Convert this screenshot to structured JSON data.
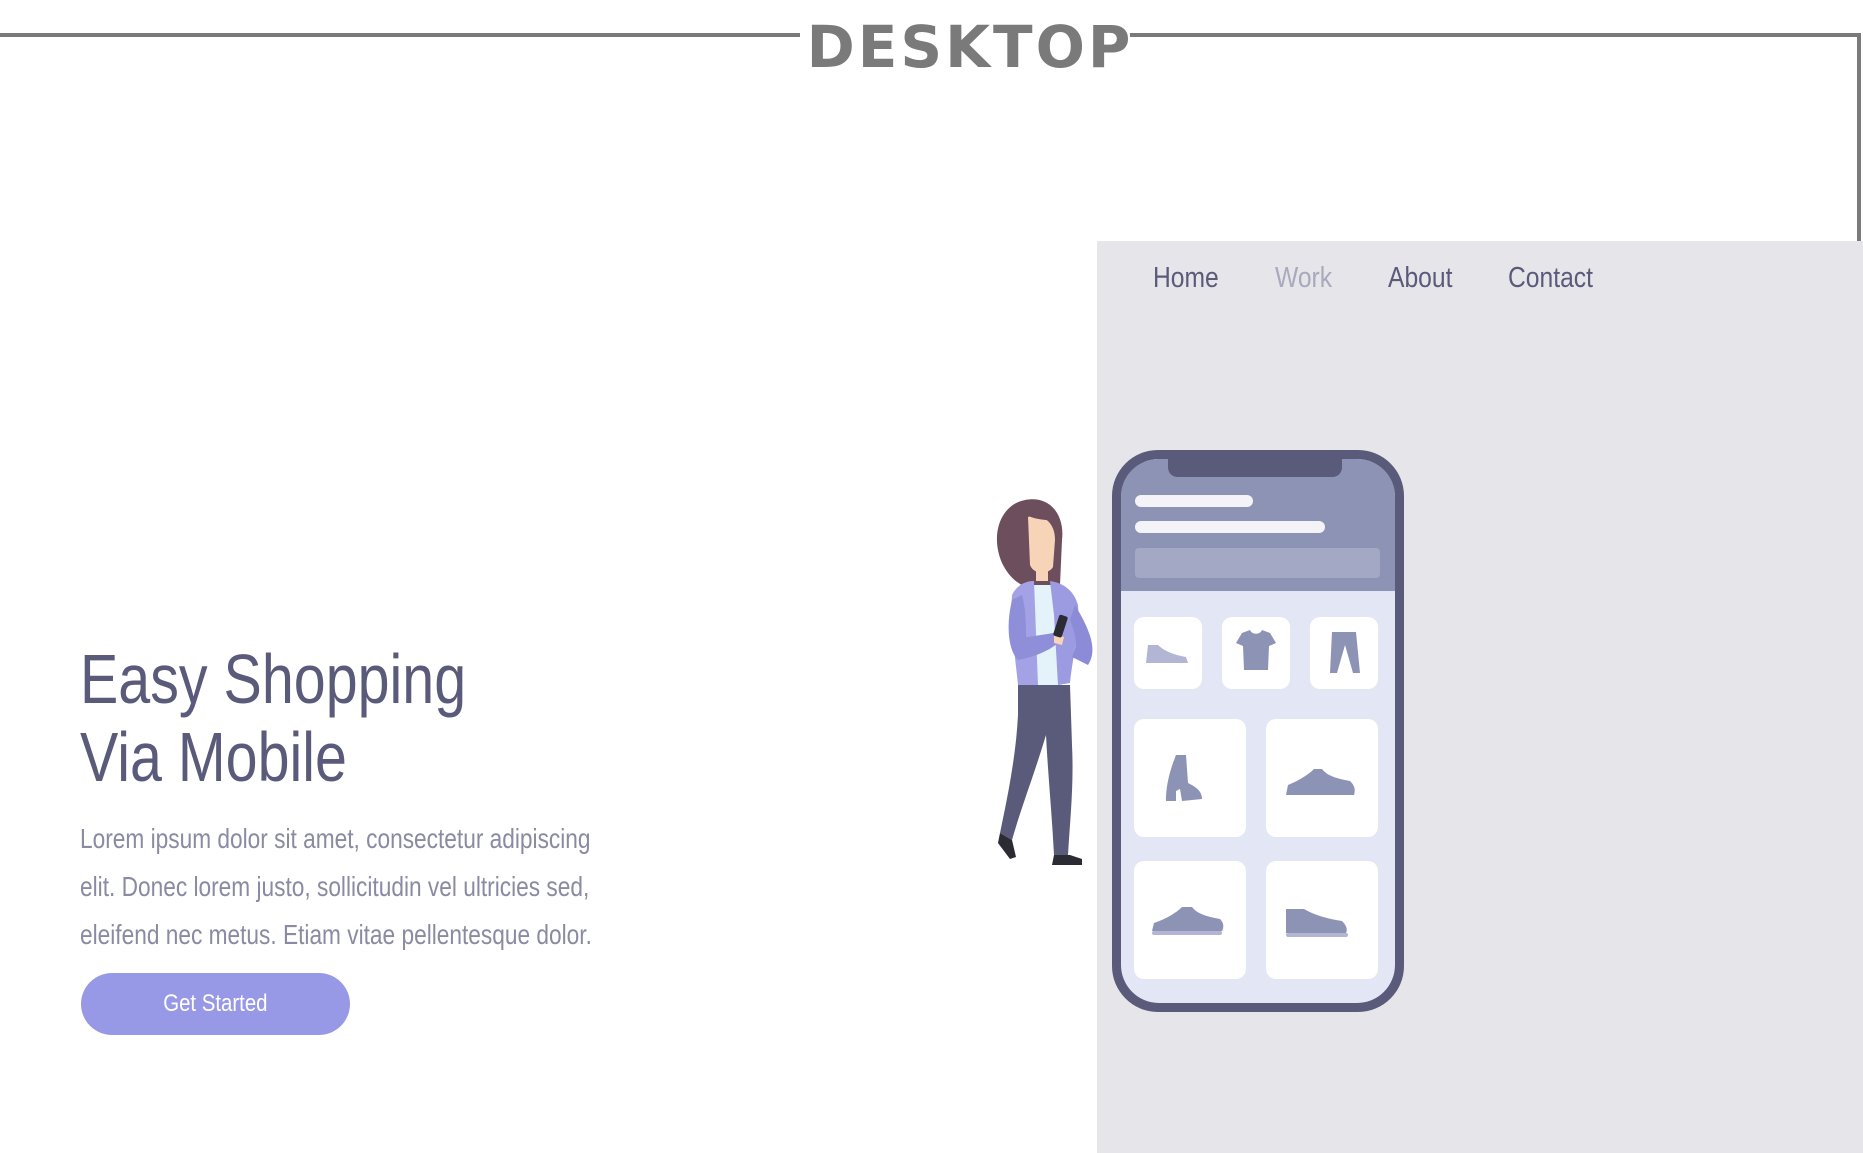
{
  "frame": {
    "label": "DESKTOP"
  },
  "nav": {
    "items": [
      {
        "label": "Home",
        "active": false
      },
      {
        "label": "Work",
        "active": true
      },
      {
        "label": "About",
        "active": false
      },
      {
        "label": "Contact",
        "active": false
      }
    ]
  },
  "hero": {
    "title_line1": "Easy Shopping",
    "title_line2": "Via Mobile",
    "body": "Lorem ipsum dolor sit amet, consectetur adipiscing elit. Donec lorem justo, sollicitudin vel ultricies sed, eleifend nec metus. Etiam vitae pellentesque dolor.",
    "cta_label": "Get Started"
  },
  "colors": {
    "text_primary": "#5a5a7a",
    "text_muted": "#8a8aa3",
    "nav_active": "#a9a9bd",
    "accent": "#9899e6",
    "panel": "#e5e5ea",
    "frame": "#7a7a7a"
  },
  "illustration": {
    "icons": [
      "shoe-icon",
      "tshirt-icon",
      "pants-icon",
      "boot-icon",
      "sneaker-icon",
      "sneaker-icon",
      "sneaker-icon"
    ]
  }
}
